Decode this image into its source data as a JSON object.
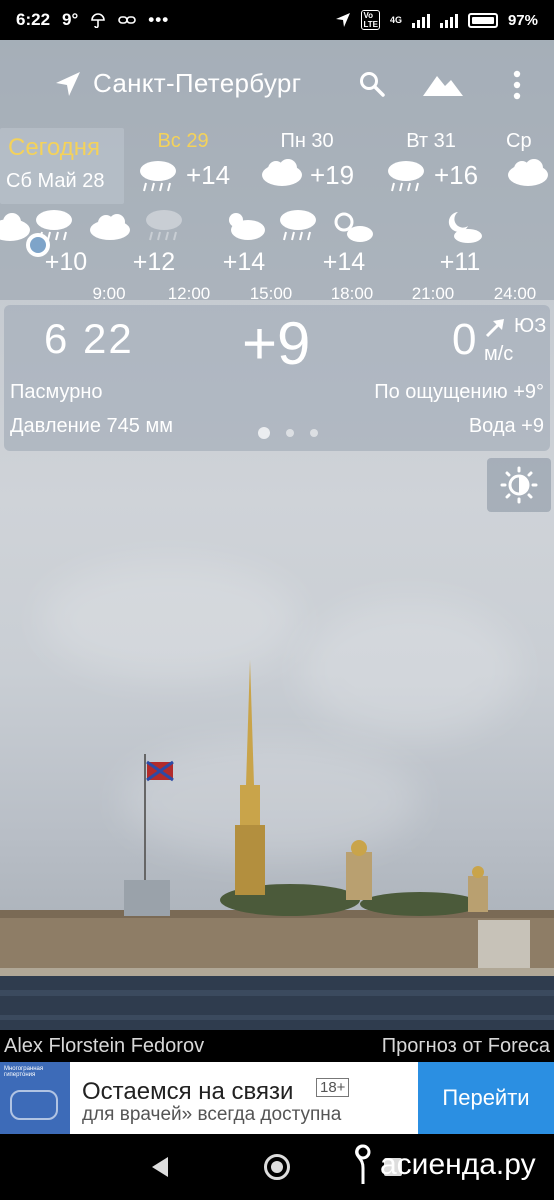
{
  "status_bar": {
    "time": "6:22",
    "weather_temp": "9°",
    "more": "•••",
    "net_badge": "4G",
    "battery": "97%"
  },
  "app_bar": {
    "city": "Санкт-Петербург",
    "icons": [
      "location-arrow-icon",
      "search-icon",
      "mountain-icon",
      "more-vert-icon"
    ]
  },
  "today": {
    "label": "Сегодня",
    "date": "Сб Май 28"
  },
  "days": [
    {
      "name": "Вс 29",
      "temp": "+14",
      "icon": "rain-icon",
      "accent": "#f4d25a"
    },
    {
      "name": "Пн 30",
      "temp": "+19",
      "icon": "cloud-icon",
      "accent": "#ffffff"
    },
    {
      "name": "Вт 31",
      "temp": "+16",
      "icon": "rain-icon",
      "accent": "#ffffff"
    },
    {
      "name": "Ср",
      "temp": "",
      "icon": "cloud-icon",
      "accent": "#ffffff"
    }
  ],
  "hourly": {
    "temps": [
      "+10",
      "+12",
      "+14",
      "+14",
      "+11"
    ],
    "times": [
      "9:00",
      "12:00",
      "15:00",
      "18:00",
      "21:00",
      "24:00"
    ]
  },
  "current": {
    "time": "6 22",
    "temp": "+9",
    "wind_speed": "0",
    "wind_dir": "ЮЗ",
    "wind_unit": "м/с",
    "condition": "Пасмурно",
    "feels_like": "По ощущению +9°",
    "pressure": "Давление 745 мм",
    "water": "Вода +9"
  },
  "credits": {
    "photo_author": "Alex Florstein Fedorov",
    "provider": "Прогноз от Foreca"
  },
  "ad": {
    "headline": "Остаемся на связи",
    "age": "18+",
    "subline": "для врачей» всегда доступна",
    "cta": "Перейти",
    "thumb_title": "Многогранная гипертония"
  },
  "watermark": "асиенда.ру"
}
